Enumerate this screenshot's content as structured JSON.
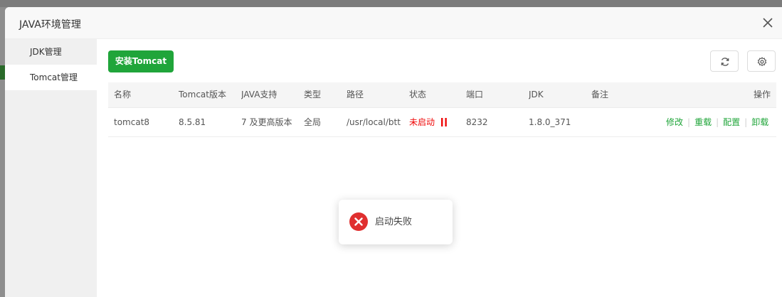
{
  "dialog": {
    "title": "JAVA环境管理"
  },
  "sidebar": {
    "items": [
      {
        "label": "JDK管理"
      },
      {
        "label": "Tomcat管理"
      }
    ]
  },
  "toolbar": {
    "install_label": "安装Tomcat",
    "refresh_icon": "refresh-icon",
    "settings_icon": "gear-icon"
  },
  "table": {
    "headers": {
      "name": "名称",
      "version": "Tomcat版本",
      "java": "JAVA支持",
      "type": "类型",
      "path": "路径",
      "status": "状态",
      "port": "端口",
      "jdk": "JDK",
      "remark": "备注",
      "actions": "操作"
    },
    "rows": [
      {
        "name": "tomcat8",
        "version": "8.5.81",
        "java": "7 及更高版本",
        "type": "全局",
        "path": "/usr/local/btt",
        "status": "未启动",
        "port": "8232",
        "jdk": "1.8.0_371",
        "remark": "",
        "actions": {
          "edit": "修改",
          "reload": "重载",
          "config": "配置",
          "uninstall": "卸载"
        }
      }
    ]
  },
  "toast": {
    "message": "启动失败",
    "icon": "error-icon"
  },
  "colors": {
    "accent": "#20a53a",
    "error": "#e02f2f",
    "status_stopped": "#ef0808"
  }
}
